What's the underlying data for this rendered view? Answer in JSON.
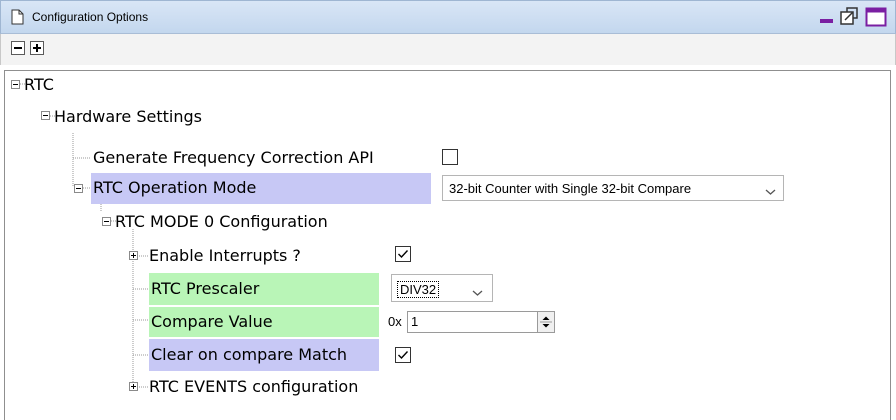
{
  "window": {
    "title": "Configuration Options",
    "icons": [
      "document-icon",
      "minimize-icon",
      "restore-icon",
      "maximize-icon"
    ]
  },
  "toolbar": {
    "buttons": [
      "collapse-all-icon",
      "expand-all-icon"
    ]
  },
  "tree": {
    "rtc": "RTC",
    "hardware_settings": "Hardware Settings",
    "gen_freq_api": {
      "label": "Generate Frequency Correction API",
      "checked": false
    },
    "operation_mode": {
      "label": "RTC Operation Mode",
      "value": "32-bit Counter with Single 32-bit Compare"
    },
    "mode0_config": "RTC MODE 0 Configuration",
    "enable_interrupts": {
      "label": "Enable Interrupts ?",
      "checked": true
    },
    "prescaler": {
      "label": "RTC Prescaler",
      "value": "DIV32"
    },
    "compare_value": {
      "label": "Compare Value",
      "prefix": "0x",
      "value": "1"
    },
    "clear_on_match": {
      "label": "Clear on compare Match",
      "checked": true
    },
    "events_config": "RTC EVENTS configuration"
  },
  "colors": {
    "highlight_purple": "#c7c8f5",
    "highlight_green": "#b9f5b7",
    "titlebar": "#c3d7ee"
  }
}
